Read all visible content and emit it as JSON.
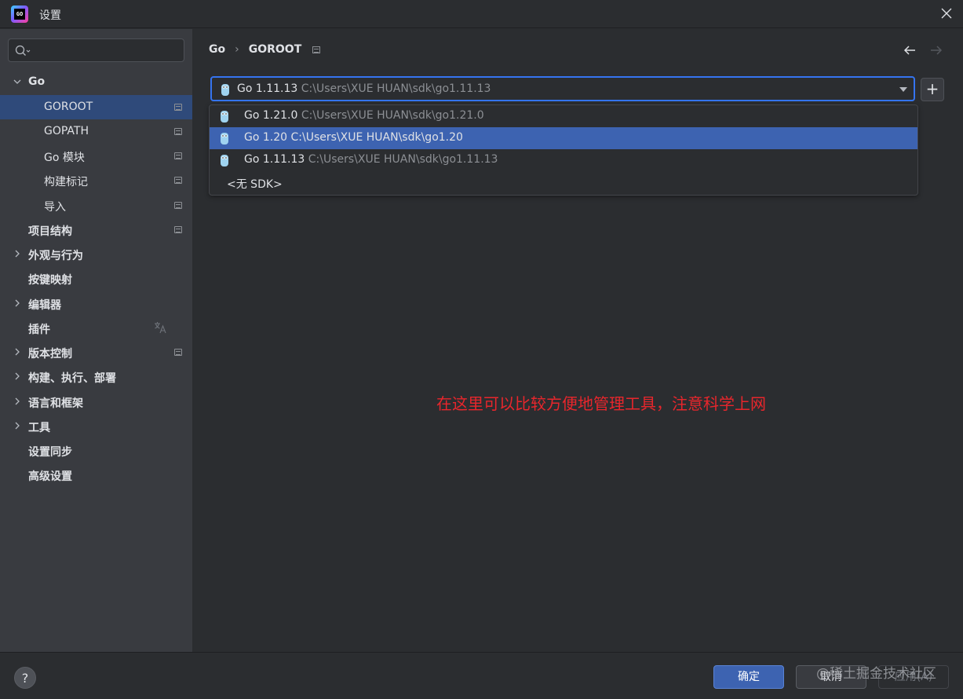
{
  "window": {
    "title": "设置"
  },
  "sidebar": {
    "search": {
      "placeholder": "",
      "value": ""
    },
    "items": [
      {
        "label": "Go",
        "expanded": true,
        "level": 0
      },
      {
        "label": "GOROOT",
        "level": 1,
        "selected": true
      },
      {
        "label": "GOPATH",
        "level": 1
      },
      {
        "label": "Go 模块",
        "level": 1
      },
      {
        "label": "构建标记",
        "level": 1
      },
      {
        "label": "导入",
        "level": 1
      },
      {
        "label": "项目结构",
        "level": 0
      },
      {
        "label": "外观与行为",
        "level": 0,
        "collapsed": true
      },
      {
        "label": "按键映射",
        "level": 0
      },
      {
        "label": "编辑器",
        "level": 0,
        "collapsed": true
      },
      {
        "label": "插件",
        "level": 0
      },
      {
        "label": "版本控制",
        "level": 0,
        "collapsed": true
      },
      {
        "label": "构建、执行、部署",
        "level": 0,
        "collapsed": true
      },
      {
        "label": "语言和框架",
        "level": 0,
        "collapsed": true
      },
      {
        "label": "工具",
        "level": 0,
        "collapsed": true
      },
      {
        "label": "设置同步",
        "level": 0
      },
      {
        "label": "高级设置",
        "level": 0
      }
    ]
  },
  "breadcrumb": {
    "parent": "Go",
    "current": "GOROOT"
  },
  "sdk_selector": {
    "selected_name": "Go 1.11.13",
    "selected_path": "C:\\Users\\XUE HUAN\\sdk\\go1.11.13",
    "add_label": "+"
  },
  "dropdown": {
    "options": [
      {
        "name": "Go 1.21.0",
        "path": "C:\\Users\\XUE HUAN\\sdk\\go1.21.0"
      },
      {
        "name": "Go 1.20",
        "path": "C:\\Users\\XUE HUAN\\sdk\\go1.20",
        "highlighted": true
      },
      {
        "name": "Go 1.11.13",
        "path": "C:\\Users\\XUE HUAN\\sdk\\go1.11.13"
      }
    ],
    "no_sdk": "<无 SDK>"
  },
  "annotation": "在这里可以比较方便地管理工具，注意科学上网",
  "footer": {
    "help": "?",
    "ok": "确定",
    "cancel": "取消",
    "apply": "应用(A)",
    "watermark": "@稀土掘金技术社区"
  },
  "colors": {
    "accent": "#3574f0",
    "selection": "#2f4a7a",
    "annotation": "#e8262c",
    "background": "#2b2d30",
    "sidebar": "#393b40"
  }
}
